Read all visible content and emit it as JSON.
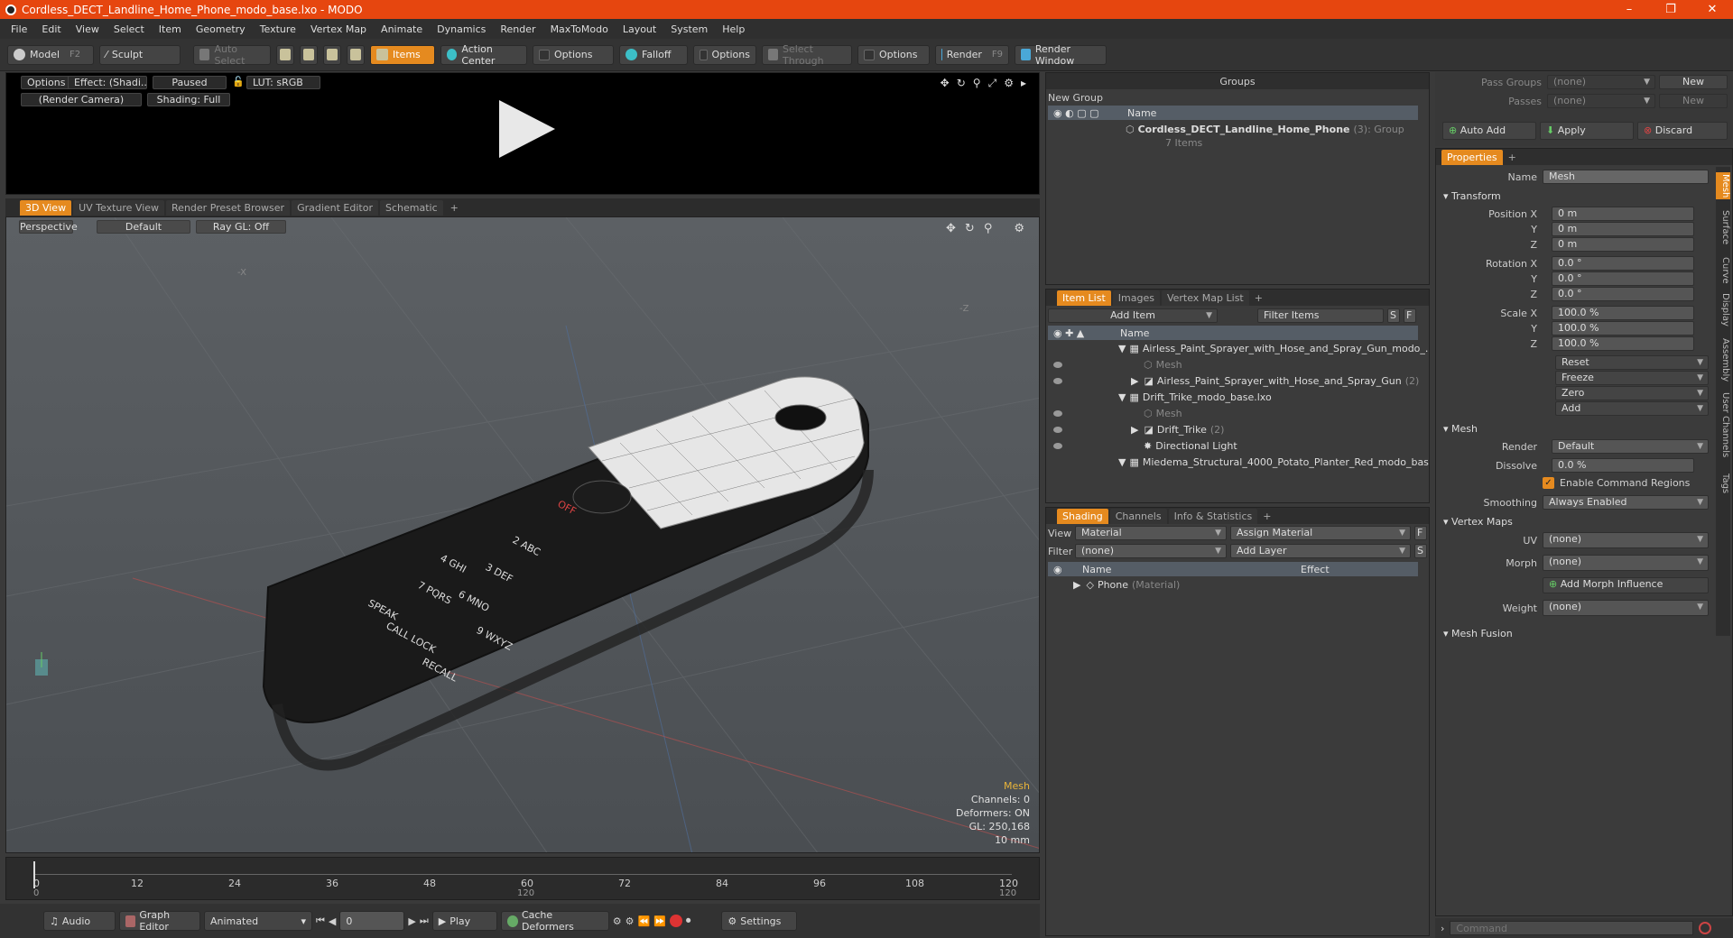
{
  "window": {
    "title": "Cordless_DECT_Landline_Home_Phone_modo_base.lxo - MODO"
  },
  "menu": [
    "File",
    "Edit",
    "View",
    "Select",
    "Item",
    "Geometry",
    "Texture",
    "Vertex Map",
    "Animate",
    "Dynamics",
    "Render",
    "MaxToModo",
    "Layout",
    "System",
    "Help"
  ],
  "toolbar": {
    "model": "Model",
    "model_key": "F2",
    "sculpt": "Sculpt",
    "auto_select": "Auto Select",
    "items": "Items",
    "action_center": "Action Center",
    "options1": "Options",
    "falloff": "Falloff",
    "options2": "Options",
    "select_through": "Select Through",
    "options3": "Options",
    "render": "Render",
    "render_key": "F9",
    "render_window": "Render Window"
  },
  "preview": {
    "options": "Options",
    "effect": "Effect: (Shadi...",
    "paused": "Paused",
    "lut": "LUT: sRGB",
    "camera": "(Render Camera)",
    "shading": "Shading: Full"
  },
  "view_tabs": [
    "3D View",
    "UV Texture View",
    "Render Preset Browser",
    "Gradient Editor",
    "Schematic"
  ],
  "viewport": {
    "perspective": "Perspective",
    "default": "Default",
    "raygl": "Ray GL: Off",
    "hud": {
      "selection": "Mesh",
      "channels": "Channels: 0",
      "deformers": "Deformers: ON",
      "gl": "GL: 250,168",
      "unit": "10 mm"
    },
    "axis_x": "-X",
    "axis_z": "-Z"
  },
  "timeline": {
    "ticks": [
      "0",
      "12",
      "24",
      "36",
      "48",
      "60",
      "72",
      "84",
      "96",
      "108",
      "120"
    ],
    "sub_ticks": [
      "0",
      "120",
      "120"
    ]
  },
  "bottom": {
    "audio": "Audio",
    "graph_editor": "Graph Editor",
    "animated": "Animated",
    "frame": "0",
    "play": "Play",
    "cache_deformers": "Cache Deformers",
    "settings": "Settings"
  },
  "groups": {
    "title": "Groups",
    "new_group": "New Group",
    "col_name": "Name",
    "item_name": "Cordless_DECT_Landline_Home_Phone",
    "item_count": "(3)",
    "item_type": ": Group",
    "item_sub": "7 Items"
  },
  "item_list": {
    "tabs": [
      "Item List",
      "Images",
      "Vertex Map List"
    ],
    "add_item": "Add Item",
    "filter_items": "Filter Items",
    "s": "S",
    "f": "F",
    "col_name": "Name",
    "rows": [
      {
        "text": "Airless_Paint_Sprayer_with_Hose_and_Spray_Gun_modo_...",
        "extra": ""
      },
      {
        "text": "Mesh",
        "extra": ""
      },
      {
        "text": "Airless_Paint_Sprayer_with_Hose_and_Spray_Gun",
        "extra": "(2)"
      },
      {
        "text": "Drift_Trike_modo_base.lxo",
        "extra": ""
      },
      {
        "text": "Mesh",
        "extra": ""
      },
      {
        "text": "Drift_Trike",
        "extra": "(2)"
      },
      {
        "text": "Directional Light",
        "extra": ""
      },
      {
        "text": "Miedema_Structural_4000_Potato_Planter_Red_modo_bas...",
        "extra": ""
      }
    ]
  },
  "shading": {
    "tabs": [
      "Shading",
      "Channels",
      "Info & Statistics"
    ],
    "view_label": "View",
    "view_value": "Material",
    "assign_material": "Assign Material",
    "f": "F",
    "filter_label": "Filter",
    "filter_value": "(none)",
    "add_layer": "Add Layer",
    "s": "S",
    "col_name": "Name",
    "col_effect": "Effect",
    "row_name": "Phone",
    "row_type": "(Material)"
  },
  "passes": {
    "pass_groups_label": "Pass Groups",
    "pass_groups_value": "(none)",
    "new1": "New",
    "passes_label": "Passes",
    "passes_value": "(none)",
    "new2": "New"
  },
  "actions": {
    "auto_add": "Auto Add",
    "apply": "Apply",
    "discard": "Discard"
  },
  "properties": {
    "tab": "Properties",
    "name_label": "Name",
    "name_value": "Mesh",
    "transform": "Transform",
    "position_label": "Position X",
    "y": "Y",
    "z": "Z",
    "pos": [
      "0 m",
      "0 m",
      "0 m"
    ],
    "rotation_label": "Rotation X",
    "rot": [
      "0.0 °",
      "0.0 °",
      "0.0 °"
    ],
    "scale_label": "Scale X",
    "scale": [
      "100.0 %",
      "100.0 %",
      "100.0 %"
    ],
    "reset": "Reset",
    "freeze": "Freeze",
    "zero": "Zero",
    "add": "Add",
    "mesh": "Mesh",
    "render_label": "Render",
    "render_value": "Default",
    "dissolve_label": "Dissolve",
    "dissolve_value": "0.0 %",
    "enable_cmd": "Enable Command Regions",
    "smoothing_label": "Smoothing",
    "smoothing_value": "Always Enabled",
    "vertex_maps": "Vertex Maps",
    "uv_label": "UV",
    "uv_value": "(none)",
    "morph_label": "Morph",
    "morph_value": "(none)",
    "add_morph": "Add Morph Influence",
    "weight_label": "Weight",
    "weight_value": "(none)",
    "mesh_fusion": "Mesh Fusion",
    "side_tabs": [
      "Mesh",
      "Surface",
      "Curve",
      "Display",
      "Assembly",
      "User Channels",
      "Tags"
    ]
  },
  "command": {
    "placeholder": "Command"
  }
}
